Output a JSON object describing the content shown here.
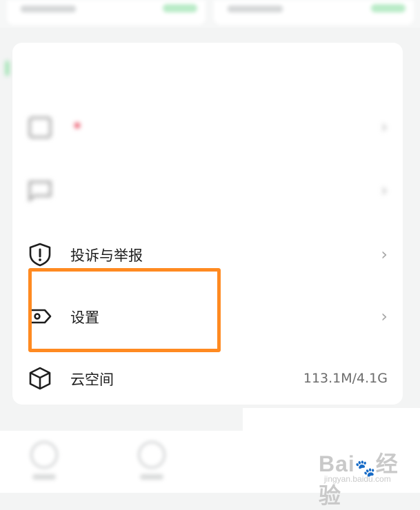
{
  "top": {
    "left_label": "",
    "right_label": ""
  },
  "section": {
    "title": ""
  },
  "menu": [
    {
      "id": "blurred-1",
      "label": "",
      "blurred": true
    },
    {
      "id": "blurred-2",
      "label": "",
      "blurred": true
    },
    {
      "id": "complaint",
      "label": "投诉与举报",
      "icon": "shield-exclamation-icon"
    },
    {
      "id": "settings",
      "label": "设置",
      "icon": "tag-settings-icon"
    },
    {
      "id": "cloud",
      "label": "云空间",
      "icon": "cube-icon",
      "value": "113.1M/4.1G"
    }
  ],
  "chevron": "›",
  "highlight_color": "#ff8a21",
  "watermark": {
    "text": "Bai",
    "suffix": "经验",
    "url": "jingyan.baidu.com"
  }
}
